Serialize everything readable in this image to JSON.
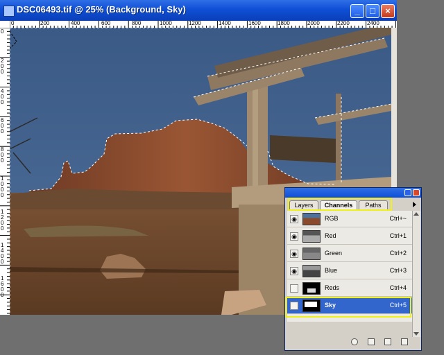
{
  "window": {
    "title": "DSC06493.tif @ 25% (Background, Sky)",
    "controls": {
      "minimize": "_",
      "maximize": "□",
      "close": "×"
    }
  },
  "ruler": {
    "h_labels": [
      "0",
      "200",
      "400",
      "600",
      "800",
      "1000",
      "1200",
      "1400",
      "1600",
      "1800",
      "2000",
      "2200",
      "2400"
    ],
    "v_labels": [
      "0",
      "2 0 0",
      "4 0 0",
      "6 0 0",
      "8 0 0",
      "1 0 0 0",
      "1 2 0 0",
      "1 4 0 0",
      "1 6 0 0"
    ]
  },
  "channels_panel": {
    "tabs": [
      {
        "label": "Layers",
        "active": false
      },
      {
        "label": "Channels",
        "active": true
      },
      {
        "label": "Paths",
        "active": false
      }
    ],
    "rows": [
      {
        "name": "RGB",
        "shortcut": "Ctrl+~",
        "visible": true,
        "selected": false,
        "thumb": "rgb"
      },
      {
        "name": "Red",
        "shortcut": "Ctrl+1",
        "visible": true,
        "selected": false,
        "thumb": "gray"
      },
      {
        "name": "Green",
        "shortcut": "Ctrl+2",
        "visible": true,
        "selected": false,
        "thumb": "gray"
      },
      {
        "name": "Blue",
        "shortcut": "Ctrl+3",
        "visible": true,
        "selected": false,
        "thumb": "gray"
      },
      {
        "name": "Reds",
        "shortcut": "Ctrl+4",
        "visible": false,
        "selected": false,
        "thumb": "mask-dark"
      },
      {
        "name": "Sky",
        "shortcut": "Ctrl+5",
        "visible": false,
        "selected": true,
        "thumb": "mask-sky"
      }
    ],
    "footer_icons": [
      "load-channel-as-selection-icon",
      "save-selection-as-channel-icon",
      "new-channel-icon",
      "delete-channel-icon"
    ]
  },
  "colors": {
    "titlebar": "#0f4fd6",
    "selection_highlight": "#3366cc",
    "callout_yellow": "#f1f11a",
    "sky": "#3c5f8c",
    "rock": "#8a4a2c",
    "ground": "#6d4526"
  }
}
